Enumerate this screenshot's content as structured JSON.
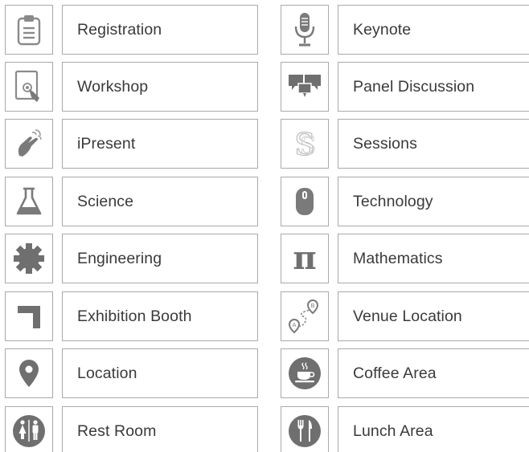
{
  "colors": {
    "icon_gray": "#7a7a7a",
    "icon_light": "#bdbdbd",
    "border": "#a9a9a9",
    "text": "#3a3a3a"
  },
  "left_items": [
    {
      "label": "Registration",
      "icon": "clipboard-icon"
    },
    {
      "label": "Workshop",
      "icon": "tablet-touch-icon"
    },
    {
      "label": "iPresent",
      "icon": "hand-gesture-icon"
    },
    {
      "label": "Science",
      "icon": "flask-icon"
    },
    {
      "label": "Engineering",
      "icon": "gear-icon"
    },
    {
      "label": "Exhibition Booth",
      "icon": "booth-corner-icon"
    },
    {
      "label": "Location",
      "icon": "map-pin-icon"
    },
    {
      "label": "Rest Room",
      "icon": "restroom-icon"
    }
  ],
  "right_items": [
    {
      "label": "Keynote",
      "icon": "microphone-icon"
    },
    {
      "label": "Panel Discussion",
      "icon": "chat-bubbles-icon"
    },
    {
      "label": "Sessions",
      "icon": "s-letter-icon"
    },
    {
      "label": "Technology",
      "icon": "mouse-icon"
    },
    {
      "label": "Mathematics",
      "icon": "pi-icon"
    },
    {
      "label": "Venue Location",
      "icon": "route-icon"
    },
    {
      "label": "Coffee Area",
      "icon": "coffee-cup-icon"
    },
    {
      "label": "Lunch Area",
      "icon": "fork-knife-icon"
    }
  ],
  "icon_glyphs": {
    "pi": "π",
    "s_letter": "S",
    "route_a": "A",
    "route_b": "B"
  }
}
